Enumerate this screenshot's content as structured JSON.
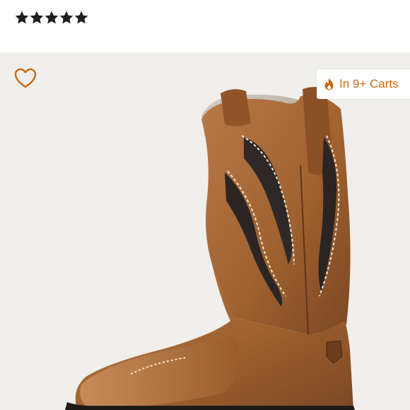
{
  "rating": {
    "stars": 5,
    "filled": 5,
    "star_color": "#1f1f1f"
  },
  "product_image": {
    "background": "#f0efec",
    "favorite_icon": "heart-outline-icon",
    "favorite_color": "#c96a17",
    "badge": {
      "icon": "flame-icon",
      "text": "In 9+ Carts",
      "color": "#c96a17"
    }
  }
}
